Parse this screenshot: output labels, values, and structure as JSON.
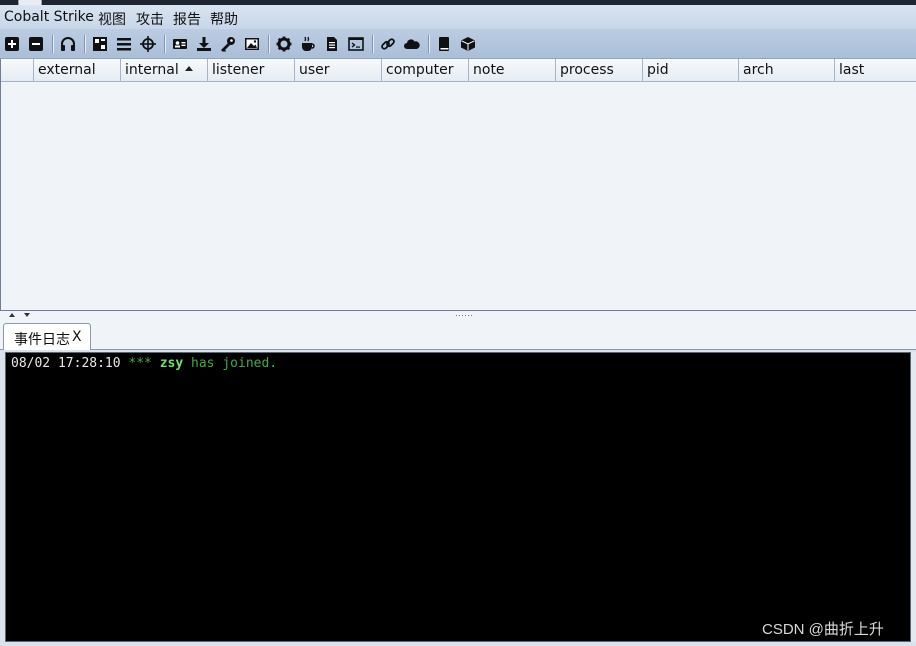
{
  "app": {
    "menu": [
      "Cobalt Strike",
      "视图",
      "攻击",
      "报告",
      "帮助"
    ]
  },
  "toolbar": {
    "icons": [
      "new-connection-icon",
      "disconnect-icon",
      "listeners-headphones-icon",
      "pivot-graph-icon",
      "session-table-icon",
      "targets-crosshair-icon",
      "credentials-icon",
      "downloads-icon",
      "keystrokes-key-icon",
      "screenshots-image-icon",
      "payload-generator-gear-icon",
      "java-applet-coffee-icon",
      "office-macro-document-icon",
      "powershell-terminal-icon",
      "web-drive-by-link-icon",
      "hosted-files-cloud-icon",
      "documentation-book-icon",
      "support-box-icon"
    ]
  },
  "table": {
    "columns": [
      "",
      "external",
      "internal",
      "listener",
      "user",
      "computer",
      "note",
      "process",
      "pid",
      "arch",
      "last"
    ],
    "sorted_column": "internal",
    "sort_direction": "ascending",
    "rows": []
  },
  "bottom_panel": {
    "tab_label": "事件日志",
    "tab_close": "X",
    "log": [
      {
        "time": "08/02 17:28:10",
        "stars": "***",
        "user": "zsy",
        "message": "has joined."
      }
    ]
  },
  "watermark": "CSDN @曲折上升",
  "colors": {
    "log_time": "#e8e8e8",
    "log_event": "#44aa44",
    "log_user": "#6fe36f",
    "console_bg": "#000000"
  }
}
